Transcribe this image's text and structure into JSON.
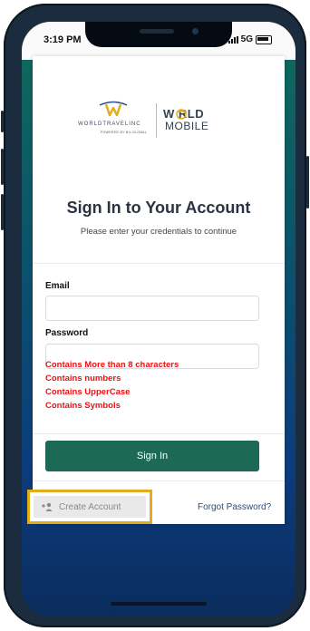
{
  "status_bar": {
    "time": "3:19 PM",
    "network": "5G"
  },
  "brand": {
    "worldtravel_name": "WORLDTRAVELINC",
    "worldtravel_tagline": "POWERED BY Bio GLOBAL",
    "worldmobile_line1": "W RLD",
    "worldmobile_line2": "MOBILE"
  },
  "header": {
    "title": "Sign In to Your Account",
    "subtitle": "Please enter your credentials to continue"
  },
  "form": {
    "email_label": "Email",
    "email_value": "",
    "password_label": "Password",
    "password_value": "",
    "rules": [
      "Contains More than 8 characters",
      "Contains numbers",
      "Contains UpperCase",
      "Contains Symbols"
    ],
    "signin_label": "Sign In"
  },
  "footer": {
    "create_account_label": "Create Account",
    "forgot_password_label": "Forgot Password?"
  },
  "colors": {
    "primary_button": "#1c6a55",
    "error_text": "#f21010",
    "highlight_border": "#e2ad1a",
    "link_text": "#2c4d7a"
  },
  "icons": [
    "add-user-icon",
    "signal-icon",
    "battery-icon"
  ]
}
